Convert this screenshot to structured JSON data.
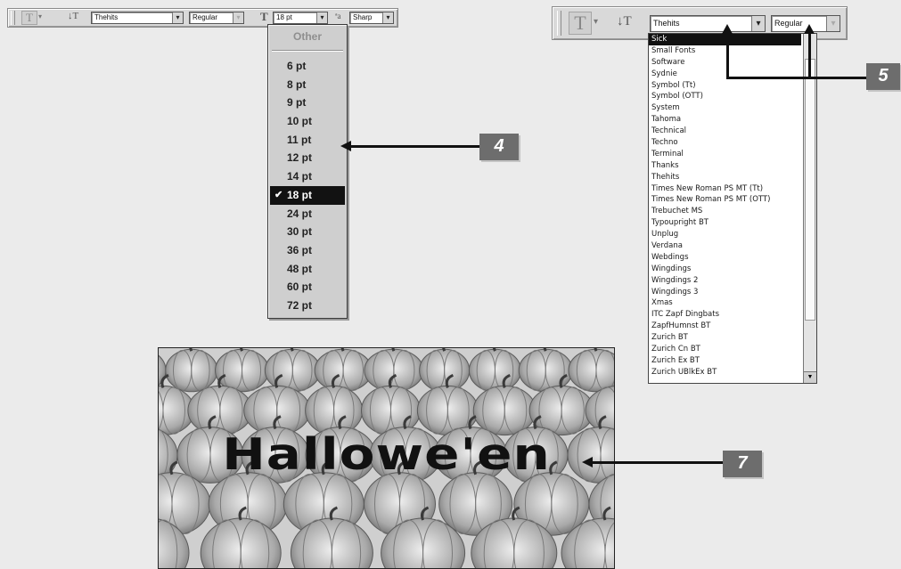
{
  "toolbar_left": {
    "font_family": "Thehits",
    "font_style": "Regular",
    "font_size": "18 pt",
    "antialias": "Sharp"
  },
  "size_menu": {
    "other_label": "Other",
    "items": [
      "6 pt",
      "8 pt",
      "9 pt",
      "10 pt",
      "11 pt",
      "12 pt",
      "14 pt",
      "18 pt",
      "24 pt",
      "30 pt",
      "36 pt",
      "48 pt",
      "60 pt",
      "72 pt"
    ],
    "selected": "18 pt"
  },
  "toolbar_right": {
    "font_family": "Thehits",
    "font_style": "Regular"
  },
  "font_menu": {
    "items": [
      "Sick",
      "Small Fonts",
      "Software",
      "Sydnie",
      "Symbol (Tt)",
      "Symbol (OTT)",
      "System",
      "Tahoma",
      "Technical",
      "Techno",
      "Terminal",
      "Thanks",
      "Thehits",
      "Times New Roman PS MT (Tt)",
      "Times New Roman PS MT (OTT)",
      "Trebuchet MS",
      "Typoupright BT",
      "Unplug",
      "Verdana",
      "Webdings",
      "Wingdings",
      "Wingdings 2",
      "Wingdings 3",
      "Xmas",
      "ITC Zapf Dingbats",
      "ZapfHumnst BT",
      "Zurich BT",
      "Zurich Cn BT",
      "Zurich Ex BT",
      "Zurich UBlkEx BT"
    ],
    "selected": "Sick"
  },
  "callouts": {
    "c4": "4",
    "c5": "5",
    "c7": "7"
  },
  "canvas_text": "Hallowe'en",
  "colors": {
    "callout_bg": "#6d6d6d",
    "selection": "#111111",
    "background": "#ebebeb"
  }
}
